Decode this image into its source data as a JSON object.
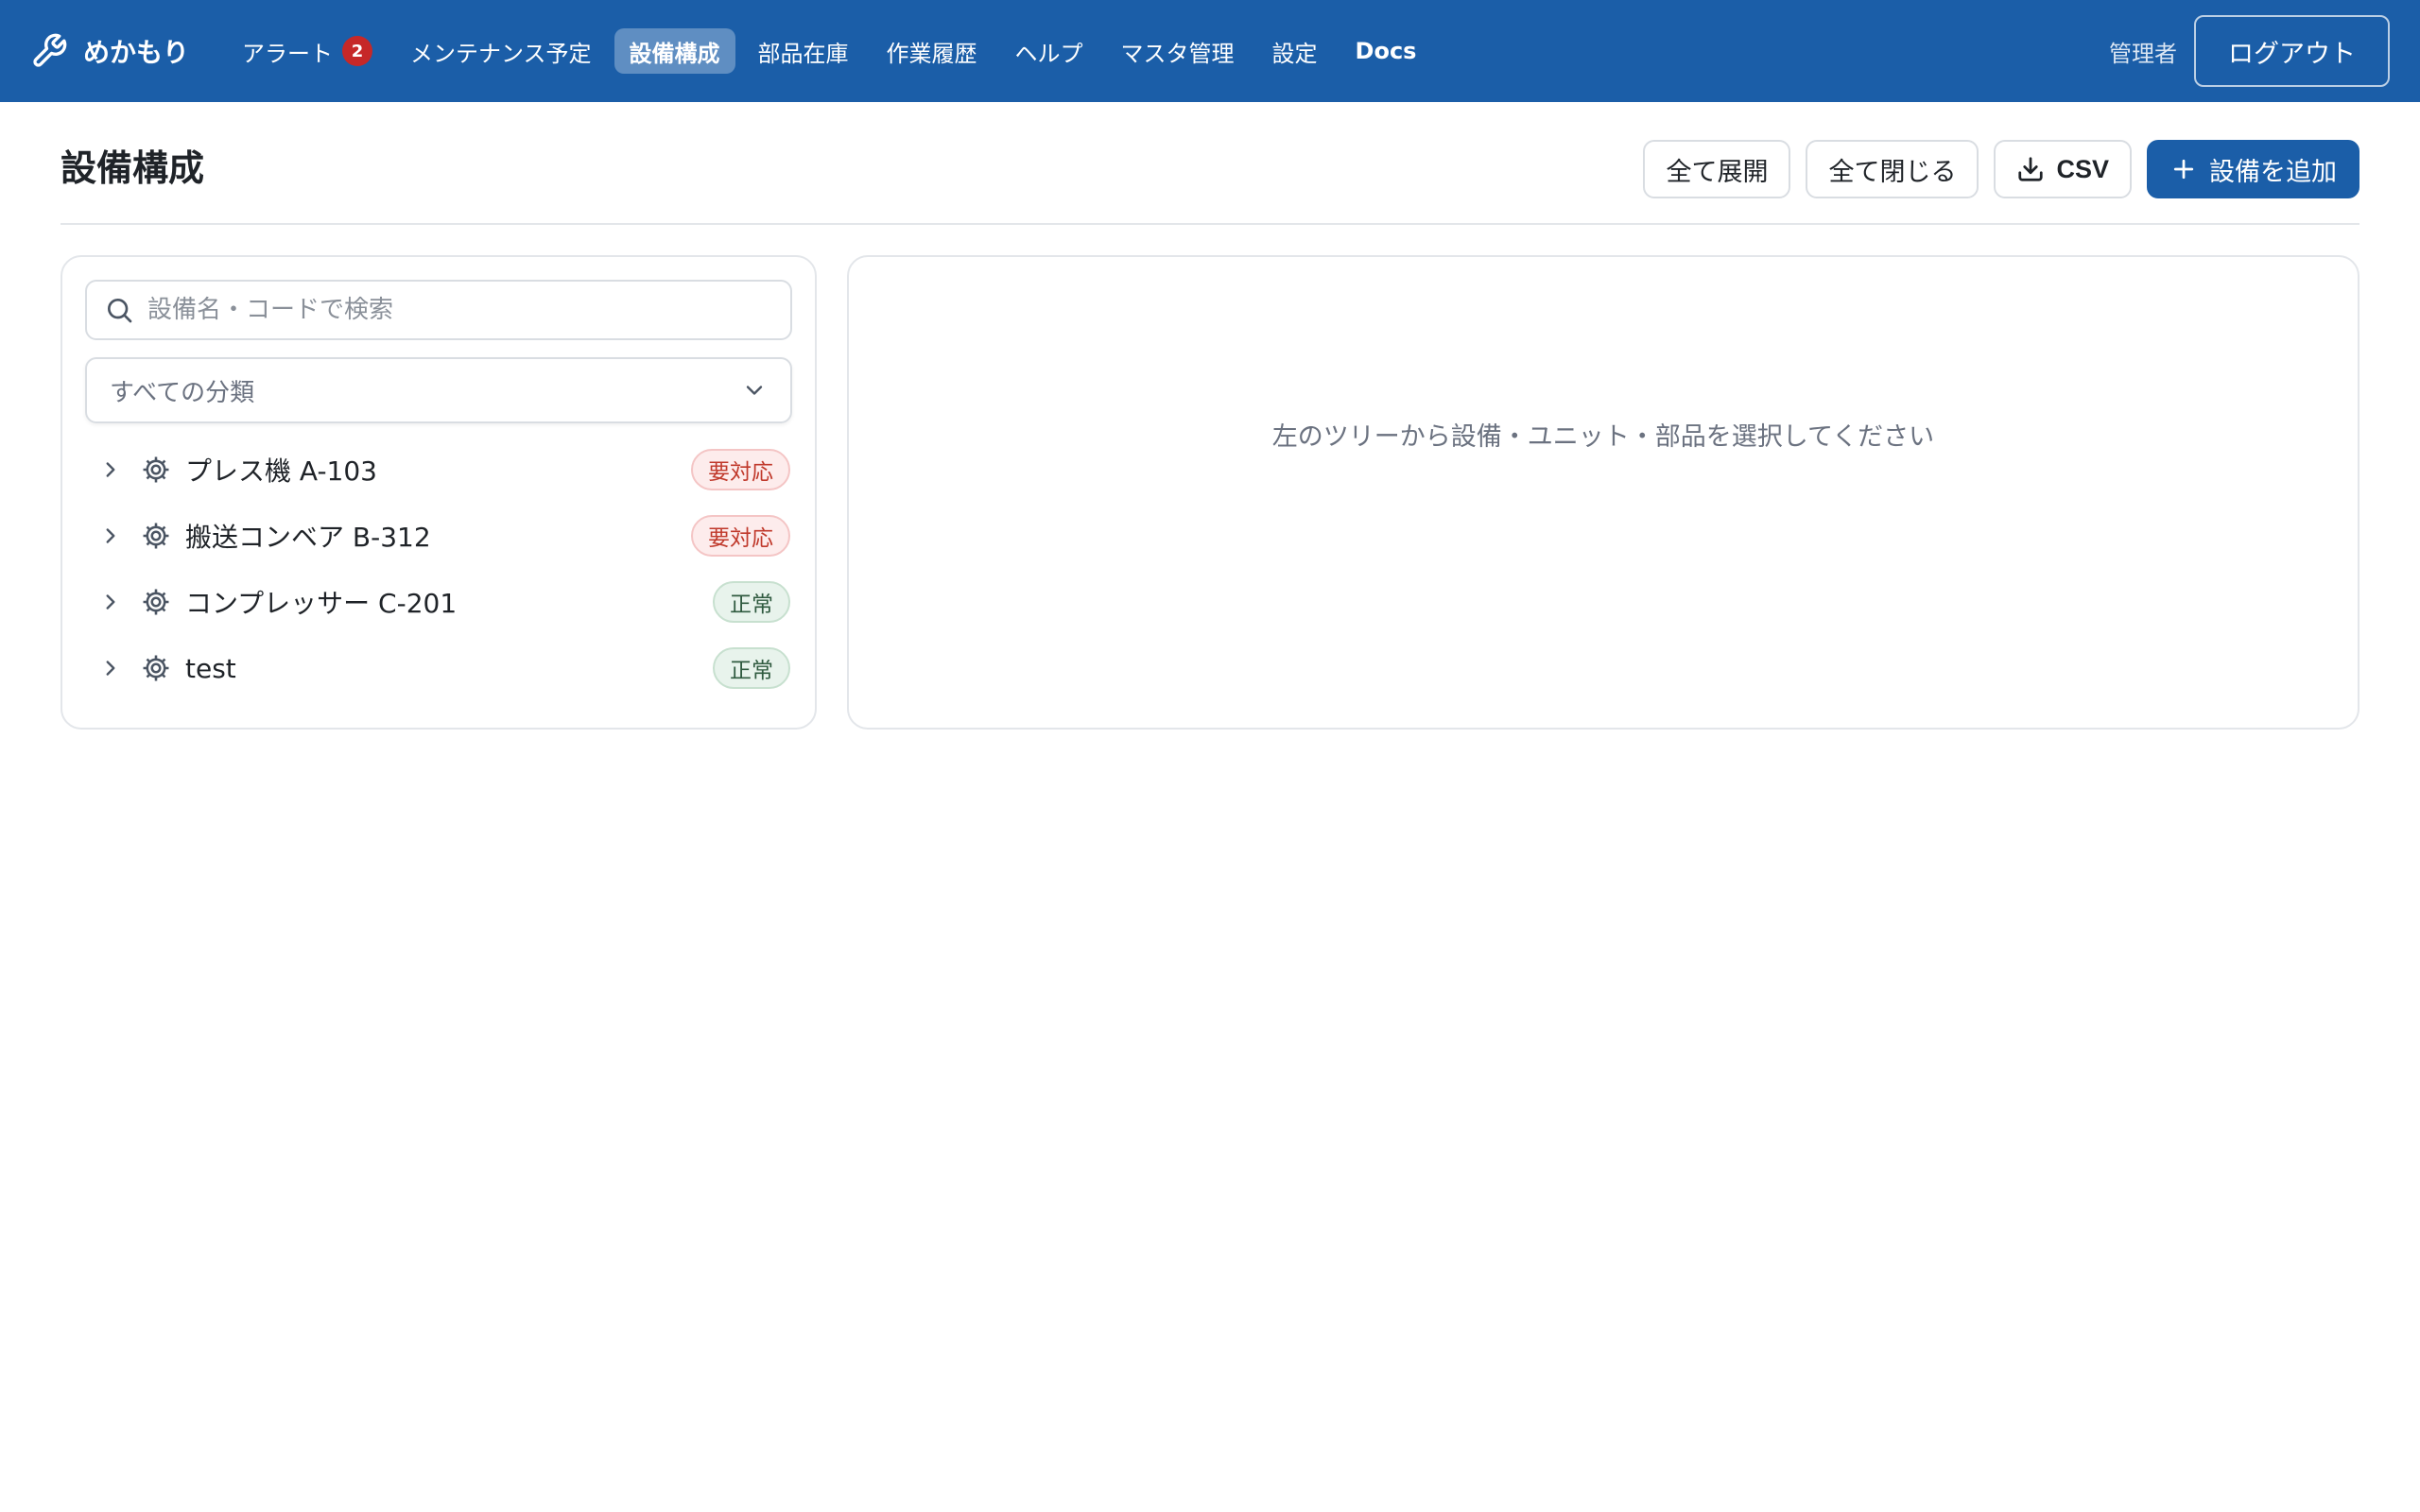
{
  "app": {
    "name": "めかもり"
  },
  "nav": {
    "items": [
      {
        "label": "アラート",
        "badge": "2"
      },
      {
        "label": "メンテナンス予定"
      },
      {
        "label": "設備構成",
        "active": true
      },
      {
        "label": "部品在庫"
      },
      {
        "label": "作業履歴"
      },
      {
        "label": "ヘルプ"
      },
      {
        "label": "マスタ管理"
      },
      {
        "label": "設定"
      },
      {
        "label": "Docs"
      }
    ]
  },
  "user": {
    "name": "管理者",
    "logout_label": "ログアウト"
  },
  "page": {
    "title": "設備構成",
    "actions": {
      "expand_all": "全て展開",
      "collapse_all": "全て閉じる",
      "csv": "CSV",
      "add_equipment": "設備を追加"
    }
  },
  "tree": {
    "search_placeholder": "設備名・コードで検索",
    "category_filter": "すべての分類",
    "items": [
      {
        "label": "プレス機 A-103",
        "status": "要対応"
      },
      {
        "label": "搬送コンベア B-312",
        "status": "要対応"
      },
      {
        "label": "コンプレッサー C-201",
        "status": "正常"
      },
      {
        "label": "test",
        "status": "正常"
      }
    ]
  },
  "detail": {
    "placeholder": "左のツリーから設備・ユニット・部品を選択してください"
  },
  "colors": {
    "brand": "#1b5ea8",
    "alert": "#c0392b",
    "ok": "#2f5a3f"
  }
}
